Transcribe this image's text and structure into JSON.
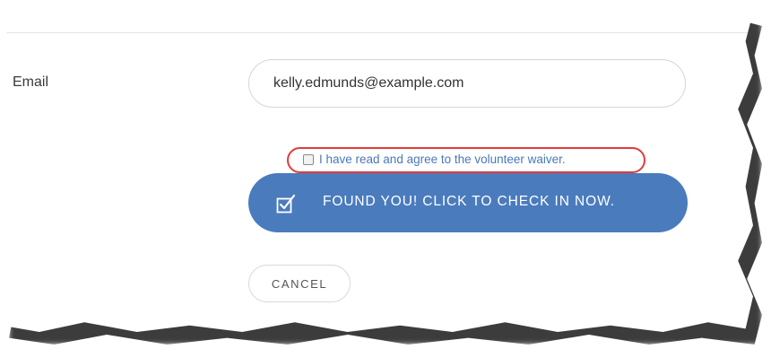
{
  "form": {
    "email_label": "Email",
    "email_value": "kelly.edmunds@example.com"
  },
  "waiver": {
    "checked": false,
    "text": "I have read and agree to the volunteer waiver.",
    "highlight_color": "#e23b3b"
  },
  "checkin_button": {
    "icon": "check-square-icon",
    "label": "FOUND YOU! CLICK TO CHECK IN NOW."
  },
  "cancel_button": {
    "label": "CANCEL"
  },
  "colors": {
    "primary_blue": "#4a7bbd",
    "link_blue": "#4a78b8",
    "annotation_red": "#e23b3b"
  }
}
